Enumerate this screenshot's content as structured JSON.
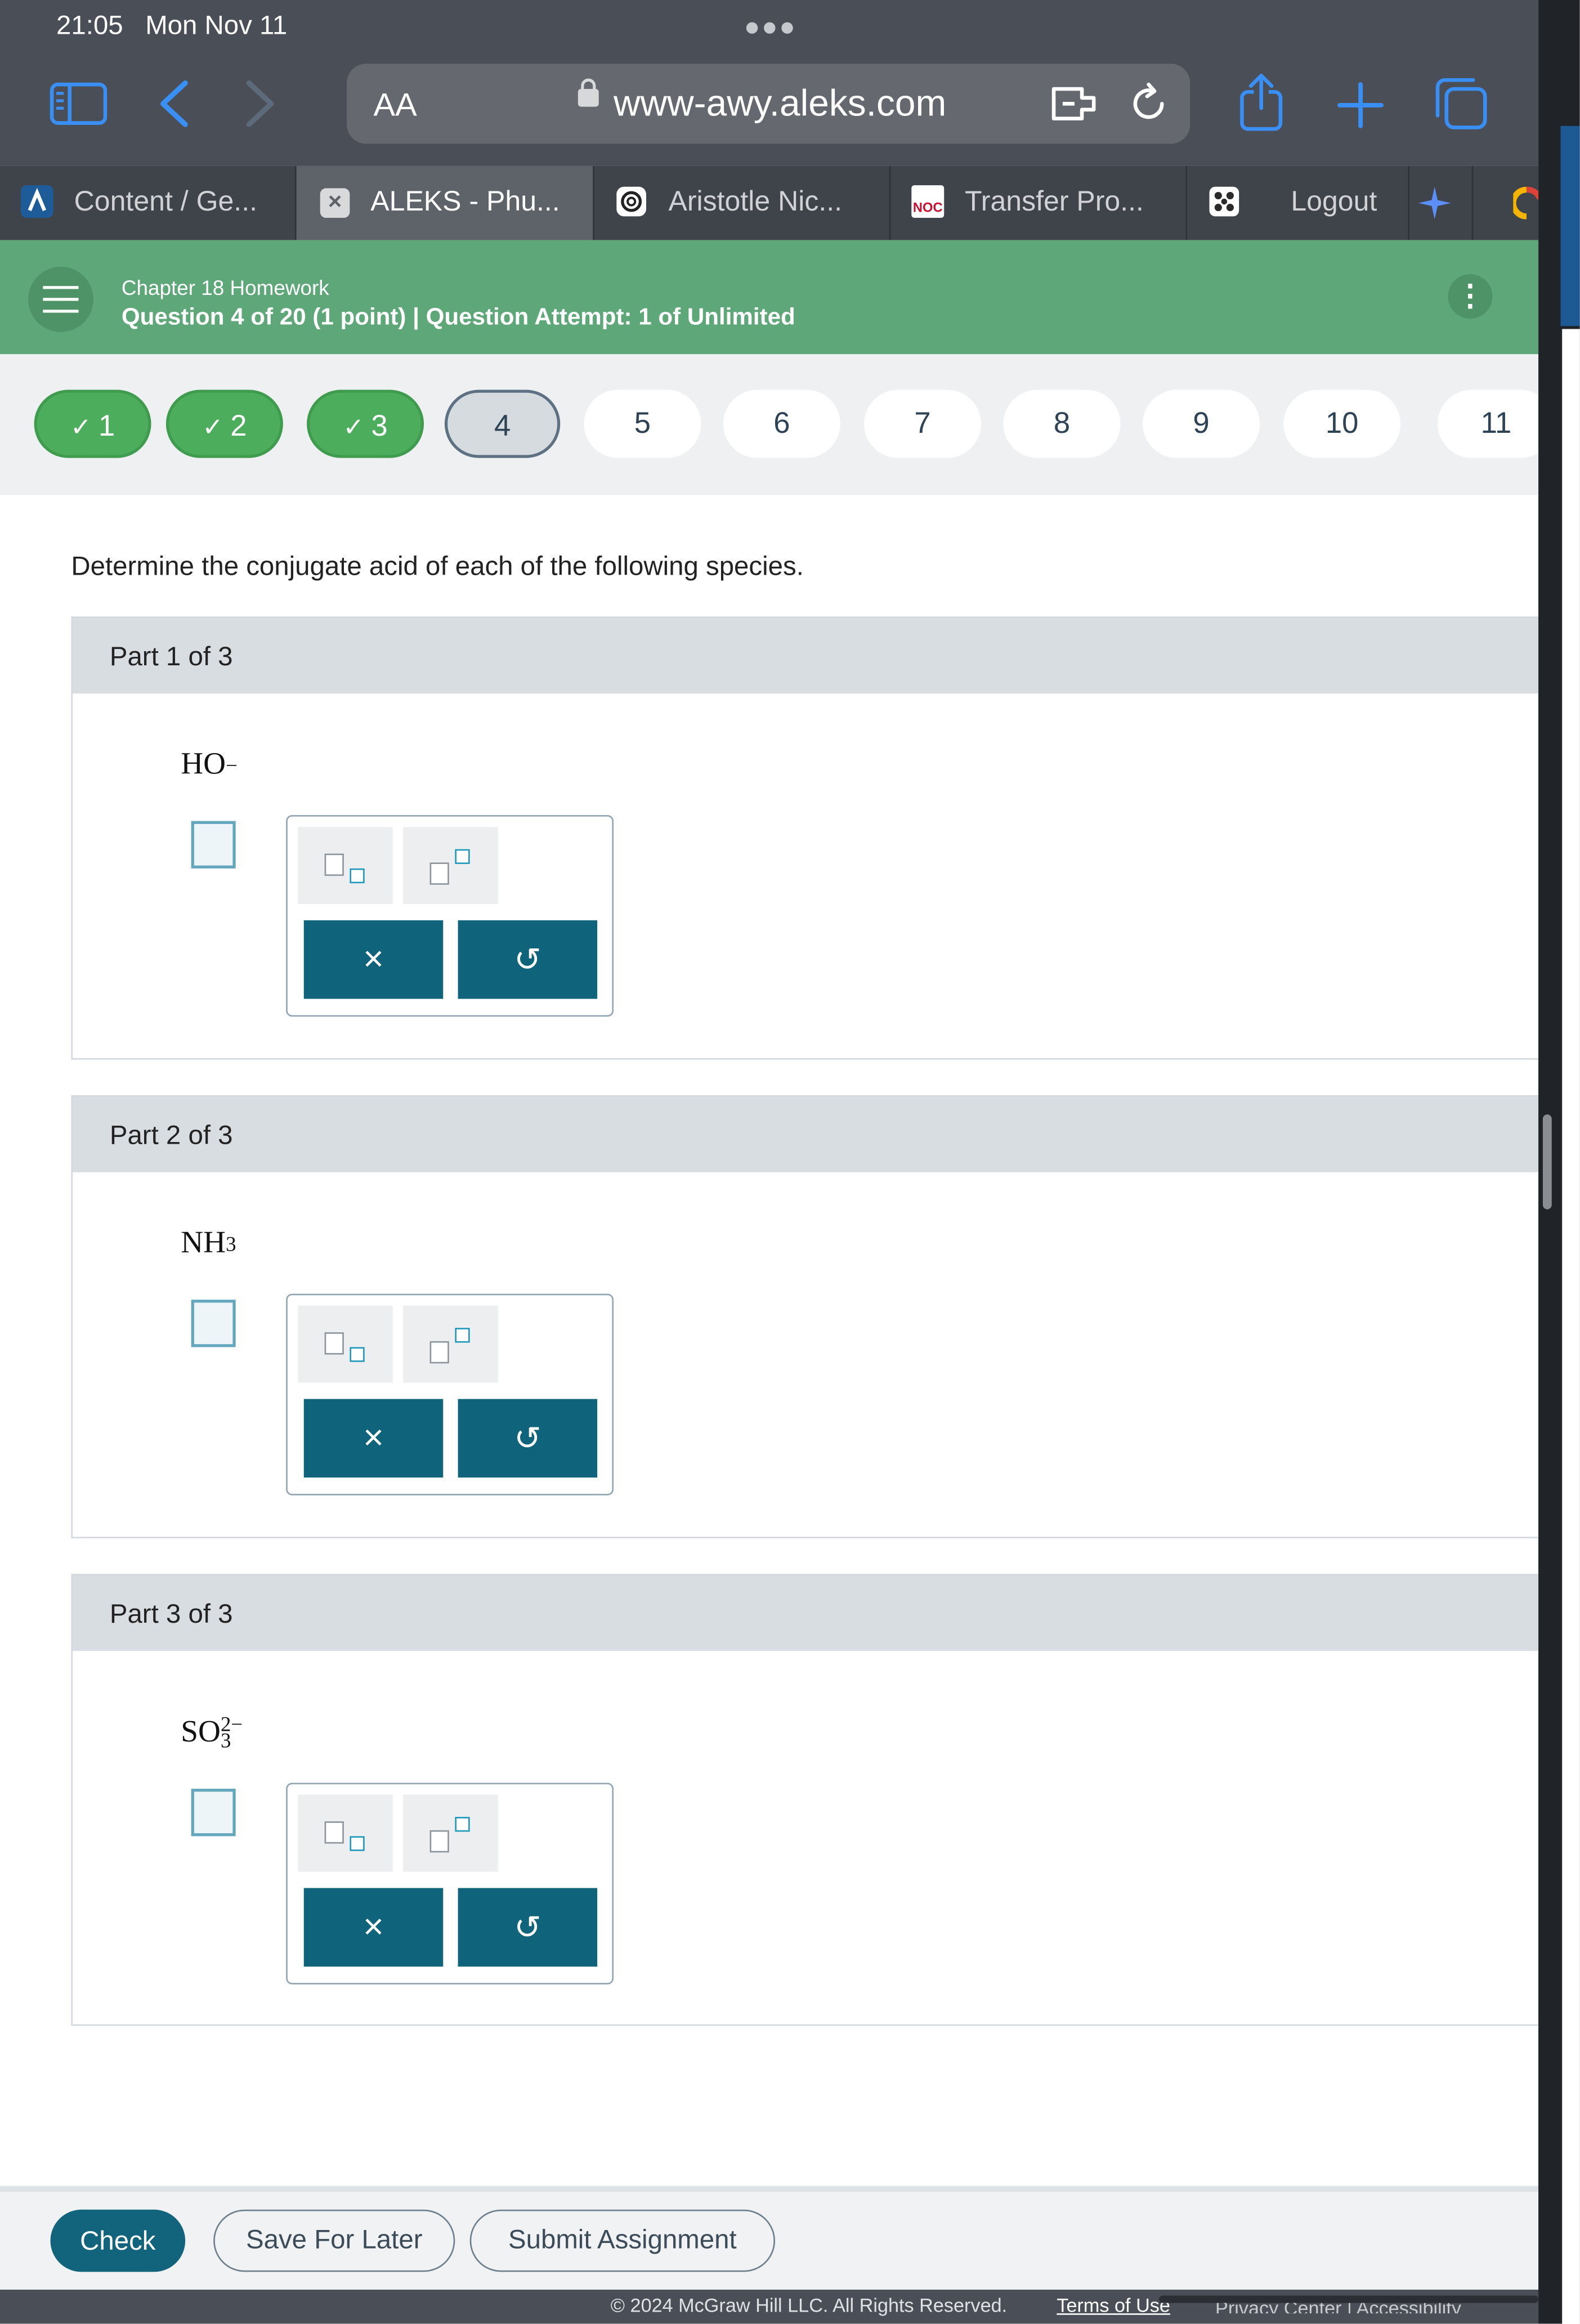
{
  "status_bar": {
    "time": "21:05",
    "date": "Mon Nov 11"
  },
  "browser": {
    "aa_label": "AA",
    "url": "www-awy.aleks.com",
    "tabs": [
      {
        "label": "Content / Ge...",
        "favicon": "aleks-icon"
      },
      {
        "label": "ALEKS - Phu...",
        "favicon": "close-icon",
        "active": true
      },
      {
        "label": "Aristotle Nic...",
        "favicon": "chatgpt-icon"
      },
      {
        "label": "Transfer Pro...",
        "favicon": "noc-icon",
        "favicon_text": "NOC"
      },
      {
        "label": "Logout",
        "favicon": "puzzle-icon"
      }
    ]
  },
  "header": {
    "title": "Chapter 18 Homework",
    "subtitle": "Question 4 of 20 (1 point)  |  Question Attempt: 1 of Unlimited"
  },
  "questions": [
    {
      "label": "1",
      "state": "done"
    },
    {
      "label": "2",
      "state": "done"
    },
    {
      "label": "3",
      "state": "done"
    },
    {
      "label": "4",
      "state": "current"
    },
    {
      "label": "5",
      "state": "todo"
    },
    {
      "label": "6",
      "state": "todo"
    },
    {
      "label": "7",
      "state": "todo"
    },
    {
      "label": "8",
      "state": "todo"
    },
    {
      "label": "9",
      "state": "todo"
    },
    {
      "label": "10",
      "state": "todo"
    },
    {
      "label": "11",
      "state": "todo"
    }
  ],
  "question_prompt": "Determine the conjugate acid of each of the following species.",
  "parts": [
    {
      "title": "Part 1 of 3",
      "formula_base": "HO",
      "formula_sub": "",
      "formula_sup": "−"
    },
    {
      "title": "Part 2 of 3",
      "formula_base": "NH",
      "formula_sub": "3",
      "formula_sup": ""
    },
    {
      "title": "Part 3 of 3",
      "formula_base": "SO",
      "formula_sub": "3",
      "formula_sup": "2−"
    }
  ],
  "palette": {
    "clear_symbol": "×",
    "undo_symbol": "↺"
  },
  "footer": {
    "check_label": "Check",
    "save_label": "Save For Later",
    "submit_label": "Submit Assignment",
    "copyright": "© 2024 McGraw Hill LLC. All Rights Reserved.",
    "terms_link": "Terms of Use",
    "cut_links": "Privacy Center   |   Accessibility"
  },
  "colors": {
    "header_green": "#5ea779",
    "done_green": "#4cae5c",
    "teal_button": "#0f637a",
    "chrome_gray": "#4a4f57"
  }
}
